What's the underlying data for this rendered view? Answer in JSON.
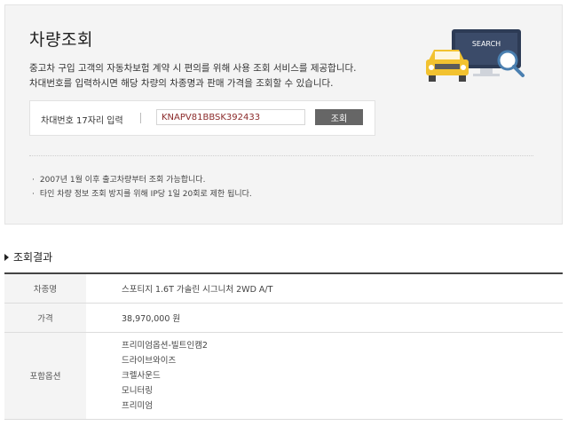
{
  "lookup": {
    "title": "차량조회",
    "desc_line1": "중고차 구입 고객의 자동차보험 계약 시 편의를 위해 사용 조회 서비스를 제공합니다.",
    "desc_line2": "차대번호를 입력하시면 해당 차량의 차종명과 판매 가격을 조회할 수 있습니다.",
    "input_label": "차대번호 17자리 입력",
    "vin_value": "KNAPV81BBSK392433",
    "search_button": "조회",
    "illustration_text": "SEARCH",
    "notes": [
      "2007년 1월 이후 출고차량부터 조회 가능합니다.",
      "타인 차량 정보 조회 방지를 위해 IP당 1일 20회로 제한 됩니다."
    ]
  },
  "result": {
    "section_title": "조회결과",
    "model_label": "차종명",
    "model_value": "스포티지 1.6T 가솔린 시그니처 2WD A/T",
    "price_label": "가격",
    "price_value": "38,970,000 원",
    "options_label": "포함옵션",
    "options": [
      "프리미엄옵션-빌트인캠2",
      "드라이브와이즈",
      "크렐사운드",
      "모니터링",
      "프리미엄"
    ]
  },
  "colors": {
    "box_bg": "#f4f4f4",
    "button_bg": "#666666",
    "vin_text": "#8b2a2a",
    "car_yellow": "#f2c230",
    "monitor_navy": "#2d3b55"
  }
}
